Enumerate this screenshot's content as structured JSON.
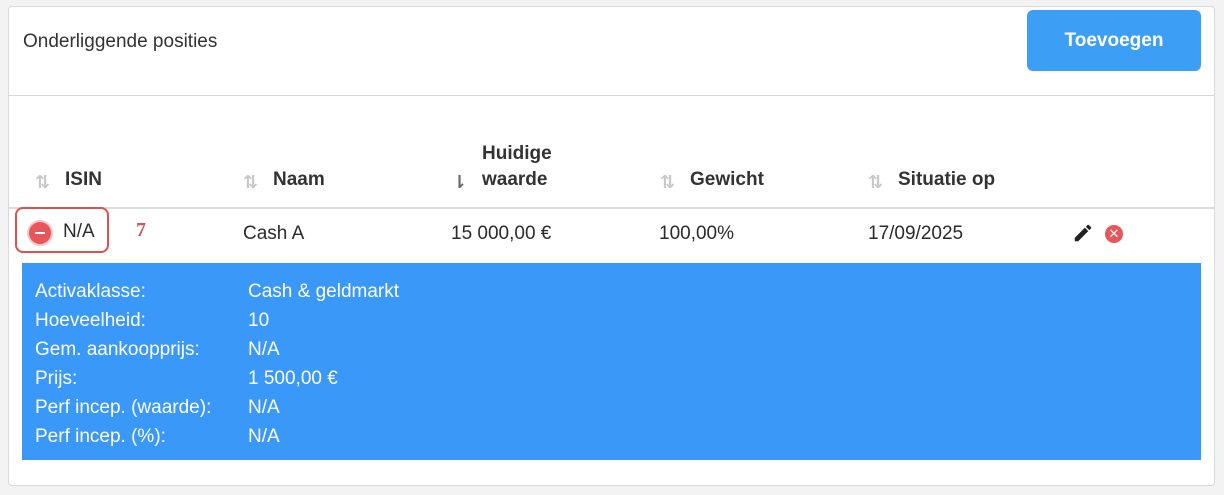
{
  "header": {
    "title": "Onderliggende posities",
    "add_label": "Toevoegen"
  },
  "table": {
    "columns": [
      {
        "label": "ISIN",
        "sorted": false
      },
      {
        "label": "Naam",
        "sorted": false
      },
      {
        "label_line1": "Huidige",
        "label_line2": "waarde",
        "sorted": true
      },
      {
        "label": "Gewicht",
        "sorted": false
      },
      {
        "label": "Situatie op",
        "sorted": false
      }
    ],
    "rows": [
      {
        "isin": "N/A",
        "naam": "Cash A",
        "waarde": "15 000,00 €",
        "gewicht": "100,00%",
        "situatie": "17/09/2025",
        "marker": "7"
      }
    ]
  },
  "details": {
    "items": [
      {
        "key": "Activaklasse:",
        "value": "Cash & geldmarkt"
      },
      {
        "key": "Hoeveelheid:",
        "value": "10"
      },
      {
        "key": "Gem. aankoopprijs:",
        "value": "N/A"
      },
      {
        "key": "Prijs:",
        "value": "1 500,00 €"
      },
      {
        "key": "Perf incep. (waarde):",
        "value": "N/A"
      },
      {
        "key": "Perf incep. (%):",
        "value": "N/A"
      }
    ]
  },
  "colors": {
    "accent": "#3d9ef5",
    "danger": "#e8565a",
    "details_bg": "#3a98f8"
  },
  "icons": [
    "sort-icon",
    "sort-desc-icon",
    "collapse-icon",
    "pencil-icon",
    "delete-icon"
  ]
}
